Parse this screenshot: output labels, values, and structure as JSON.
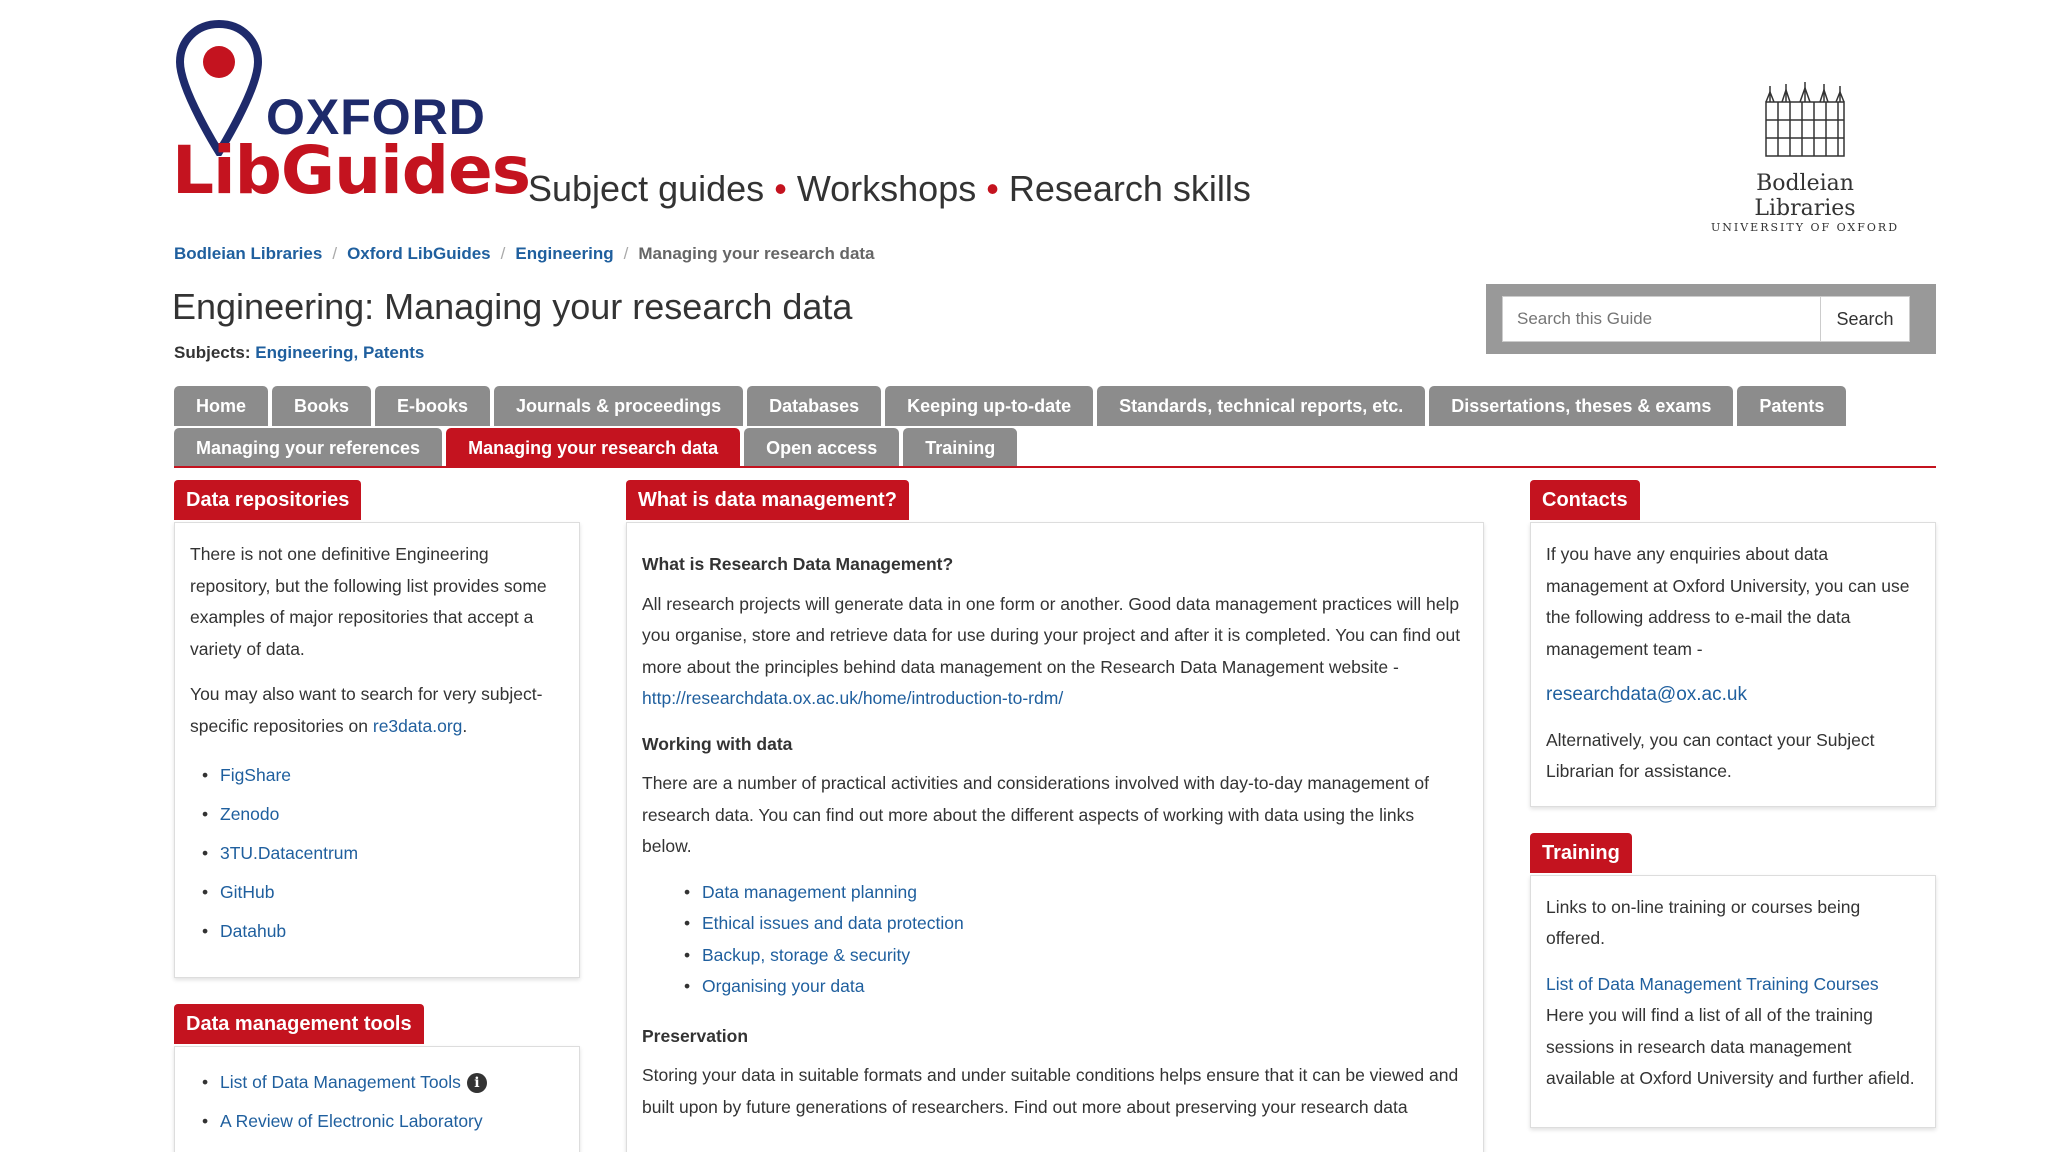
{
  "header": {
    "logo_oxford": "OXFORD",
    "logo_libguides": "LibGuides",
    "tagline": [
      "Subject guides",
      "Workshops",
      "Research skills"
    ],
    "tagline_separator": "•",
    "bodleian_name": "Bodleian Libraries",
    "bodleian_university": "UNIVERSITY OF OXFORD"
  },
  "breadcrumb": {
    "items": [
      "Bodleian Libraries",
      "Oxford LibGuides",
      "Engineering"
    ],
    "current": "Managing your research data",
    "separator": "/"
  },
  "page": {
    "title": "Engineering: Managing your research data",
    "subjects_label": "Subjects:",
    "subjects": "Engineering, Patents"
  },
  "search": {
    "placeholder": "Search this Guide",
    "button_label": "Search"
  },
  "tabs": {
    "row1": [
      "Home",
      "Books",
      "E-books",
      "Journals & proceedings",
      "Databases",
      "Keeping up-to-date",
      "Standards, technical reports, etc.",
      "Dissertations, theses & exams",
      "Patents"
    ],
    "row2": [
      "Managing your references",
      "Managing your research data",
      "Open access",
      "Training"
    ],
    "active": "Managing your research data"
  },
  "left": {
    "repos_title": "Data repositories",
    "repos_p1": "There is not one definitive Engineering repository, but the following list provides some examples of major repositories that accept a variety of data.",
    "repos_p2_text": "You may also want to search for very subject-specific repositories on ",
    "repos_p2_link": "re3data.org",
    "repos_p2_end": ".",
    "repos_links": [
      "FigShare",
      "Zenodo",
      "3TU.Datacentrum",
      "GitHub",
      "Datahub"
    ],
    "tools_title": "Data management tools",
    "tools_links": [
      "List of Data Management Tools",
      "A Review of Electronic Laboratory"
    ]
  },
  "middle": {
    "title": "What is data management?",
    "h1": "What is Research Data Management?",
    "p1": "All research projects will generate data in one form or another. Good data management practices will help you organise, store and retrieve data for use during your project and after it is completed.  You can find out more about the principles behind data management on the Research Data Management website - ",
    "p1_link": "http://researchdata.ox.ac.uk/home/introduction-to-rdm/",
    "h2": "Working with data",
    "p2": "There are a number of practical activities and considerations involved with day-to-day management of research data. You can find out more about the different aspects of working with data using the links below.",
    "links": [
      "Data management planning",
      "Ethical issues and data protection",
      "Backup, storage & security",
      "Organising your data"
    ],
    "h3": "Preservation",
    "p3": "Storing your data in suitable formats and under suitable conditions helps ensure that it can be viewed and built upon by future generations of researchers. Find out more about preserving your research data"
  },
  "right": {
    "contacts_title": "Contacts",
    "contacts_p1": "If you have any enquiries about data management at Oxford University, you can use the following address to e-mail the data management team -",
    "contacts_email": "researchdata@ox.ac.uk",
    "contacts_p2": "Alternatively, you can contact your Subject Librarian for assistance.",
    "training_title": "Training",
    "training_p1": "Links to on-line training or courses being offered.",
    "training_link": "List of Data Management Training Courses",
    "training_p2": "Here you will find a list of all of the training sessions in research data management available at Oxford University and further afield."
  },
  "colors": {
    "brand_red": "#c4131f",
    "navy": "#1e2a6b",
    "link_blue": "#1f5f9e",
    "tab_grey": "#8c8c8c"
  }
}
